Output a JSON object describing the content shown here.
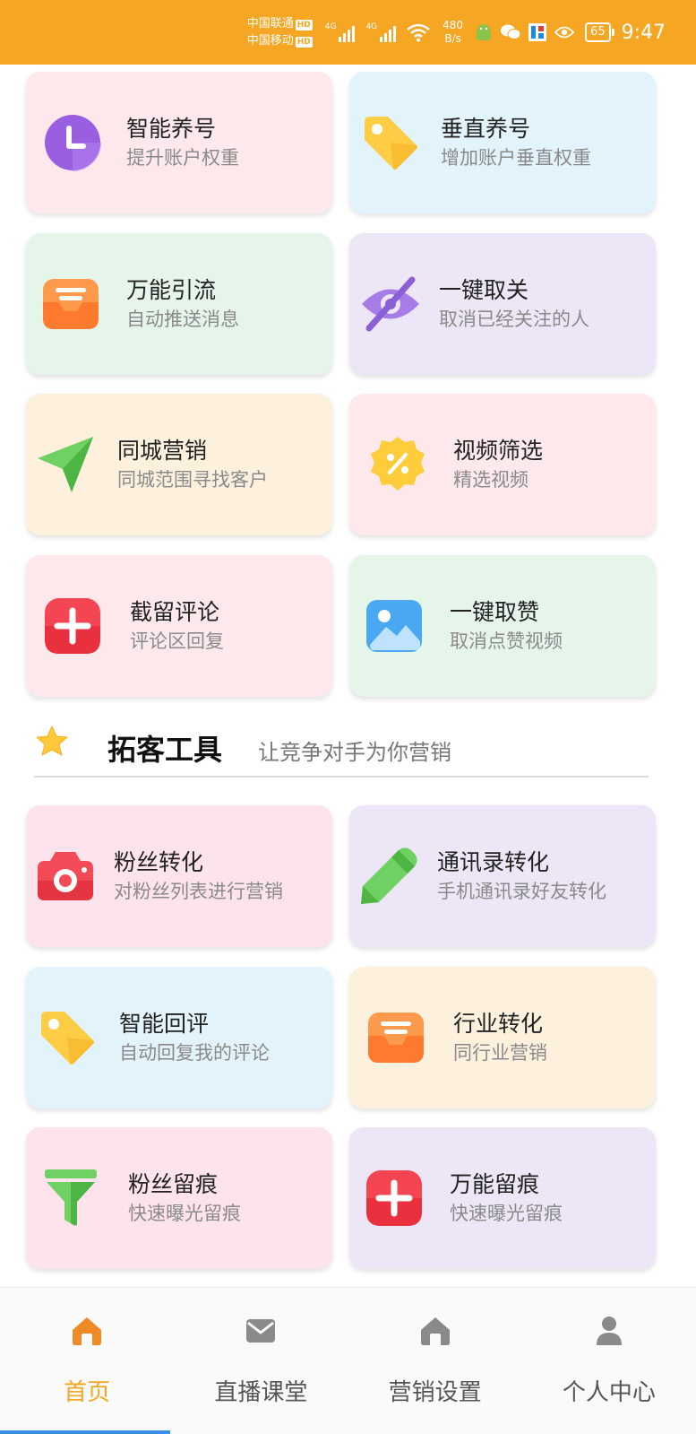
{
  "status_bar": {
    "carrier_1": "中国联通",
    "carrier_2": "中国移动",
    "hd_badge": "HD",
    "network_type": "4G",
    "speed_value": "480",
    "speed_unit": "B/s",
    "battery": "65",
    "time": "9:47",
    "background_color": "#f5a623"
  },
  "cards": [
    {
      "title": "智能养号",
      "subtitle": "提升账户权重",
      "icon": "clock-icon",
      "bg": "#fde9ec"
    },
    {
      "title": "垂直养号",
      "subtitle": "增加账户垂直权重",
      "icon": "tag-icon",
      "bg": "#e2f3fc"
    },
    {
      "title": "万能引流",
      "subtitle": "自动推送消息",
      "icon": "inbox-icon",
      "bg": "#e6f5ea"
    },
    {
      "title": "一键取关",
      "subtitle": "取消已经关注的人",
      "icon": "eye-off-icon",
      "bg": "#ece6f6"
    },
    {
      "title": "同城营销",
      "subtitle": "同城范围寻找客户",
      "icon": "send-icon",
      "bg": "#fdf1de"
    },
    {
      "title": "视频筛选",
      "subtitle": "精选视频",
      "icon": "discount-badge-icon",
      "bg": "#fde9ec"
    },
    {
      "title": "截留评论",
      "subtitle": "评论区回复",
      "icon": "plus-box-icon",
      "bg": "#fde9ec"
    },
    {
      "title": "一键取赞",
      "subtitle": "取消点赞视频",
      "icon": "image-icon",
      "bg": "#e6f5ea"
    }
  ],
  "section": {
    "title": "拓客工具",
    "subtitle": "让竞争对手为你营销",
    "icon": "star-icon"
  },
  "tool_cards": [
    {
      "title": "粉丝转化",
      "subtitle": "对粉丝列表进行营销",
      "icon": "camera-icon",
      "bg": "#fde3ec"
    },
    {
      "title": "通讯录转化",
      "subtitle": "手机通讯录好友转化",
      "icon": "pencil-icon",
      "bg": "#ece6f6"
    },
    {
      "title": "智能回评",
      "subtitle": "自动回复我的评论",
      "icon": "tag-icon",
      "bg": "#e2f3fc"
    },
    {
      "title": "行业转化",
      "subtitle": "同行业营销",
      "icon": "inbox-icon",
      "bg": "#fdf1de"
    },
    {
      "title": "粉丝留痕",
      "subtitle": "快速曝光留痕",
      "icon": "funnel-icon",
      "bg": "#fde3ec"
    },
    {
      "title": "万能留痕",
      "subtitle": "快速曝光留痕",
      "icon": "plus-box-icon",
      "bg": "#ece6f6"
    }
  ],
  "tabbar": {
    "tabs": [
      {
        "label": "首页",
        "icon": "home-icon",
        "active": true
      },
      {
        "label": "直播课堂",
        "icon": "mail-icon",
        "active": false
      },
      {
        "label": "营销设置",
        "icon": "home-icon",
        "active": false
      },
      {
        "label": "个人中心",
        "icon": "user-icon",
        "active": false
      }
    ],
    "active_color": "#f5a623",
    "inactive_color": "#555555"
  }
}
